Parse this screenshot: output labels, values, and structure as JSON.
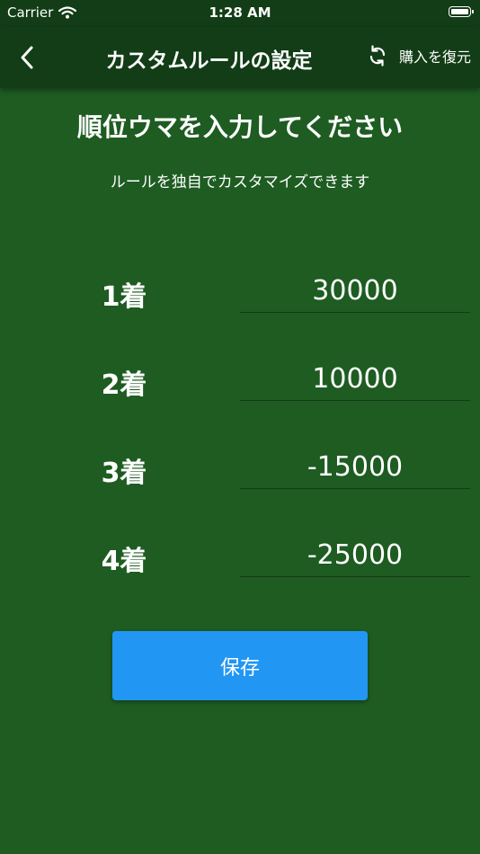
{
  "status_bar": {
    "carrier": "Carrier",
    "time": "1:28 AM"
  },
  "app_bar": {
    "title": "カスタムルールの設定",
    "restore_label": "購入を復元"
  },
  "main": {
    "heading": "順位ウマを入力してください",
    "subheading": "ルールを独自でカスタマイズできます",
    "ranks": [
      {
        "label": "1着",
        "value": "30000"
      },
      {
        "label": "2着",
        "value": "10000"
      },
      {
        "label": "3着",
        "value": "-15000"
      },
      {
        "label": "4着",
        "value": "-25000"
      }
    ],
    "save_label": "保存"
  },
  "colors": {
    "background": "#1e5c22",
    "app_bar": "#123d16",
    "save_button": "#2196f3",
    "text": "#ffffff"
  }
}
